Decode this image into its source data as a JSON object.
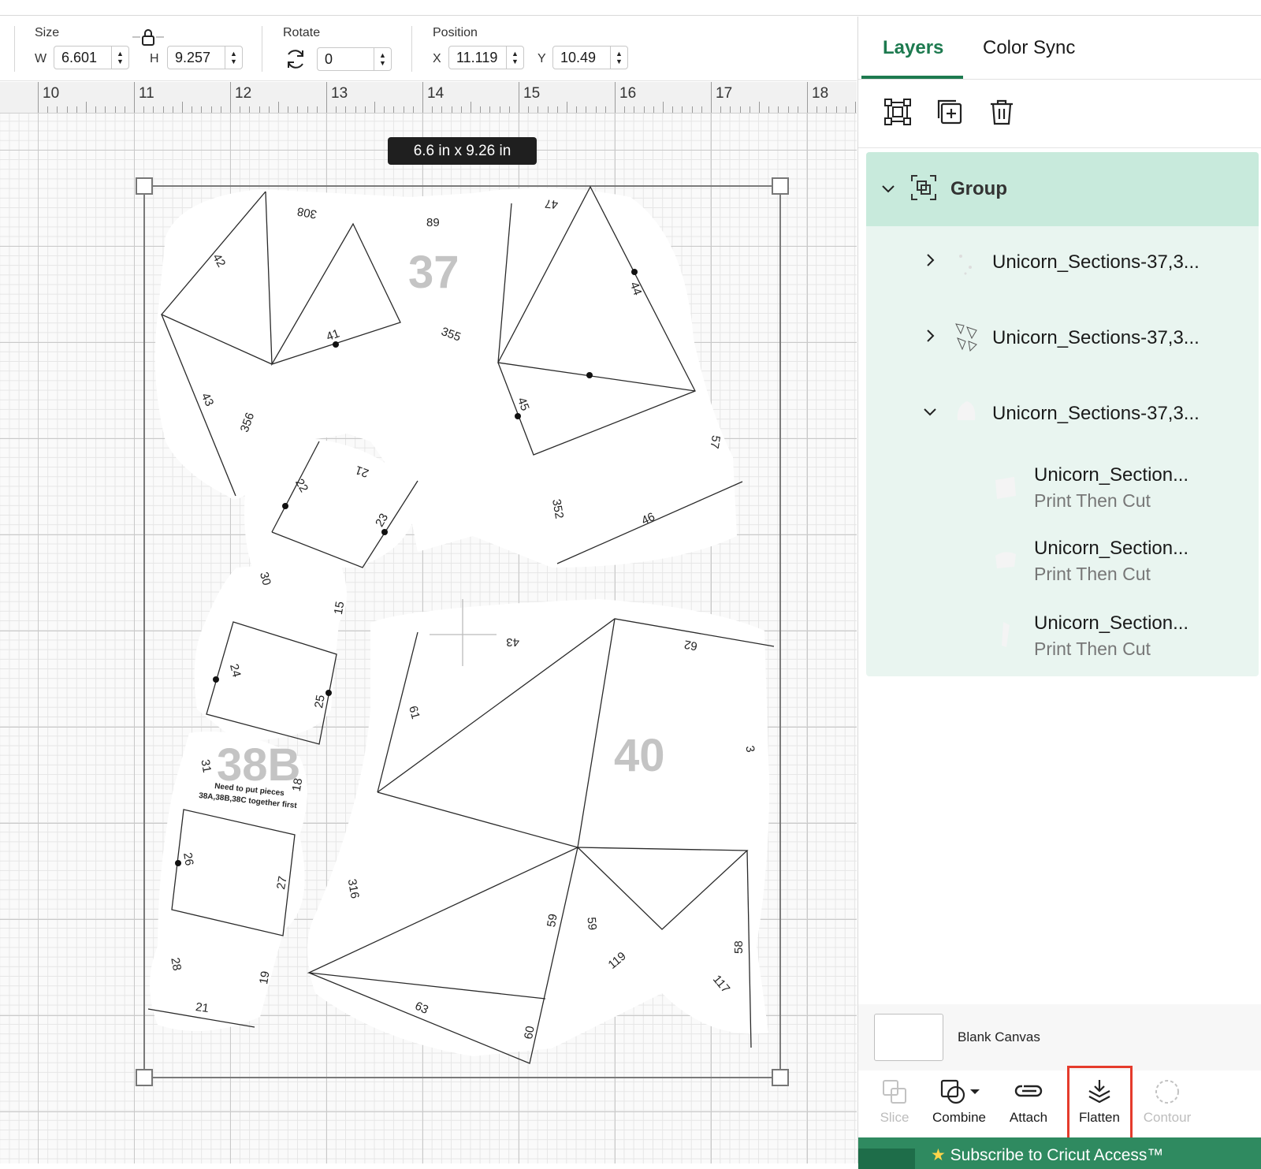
{
  "toolbar": {
    "size_label": "Size",
    "w_label": "W",
    "w_value": "6.601",
    "h_label": "H",
    "h_value": "9.257",
    "rotate_label": "Rotate",
    "rotate_value": "0",
    "position_label": "Position",
    "x_label": "X",
    "x_value": "11.119",
    "y_label": "Y",
    "y_value": "10.49"
  },
  "ruler": {
    "marks": [
      "10",
      "11",
      "12",
      "13",
      "14",
      "15",
      "16",
      "17",
      "18"
    ]
  },
  "canvas": {
    "dimension_tag": "6.6  in x 9.26  in",
    "labels": {
      "big_37": "37",
      "big_38b": "38B",
      "big_40": "40",
      "note_line1": "Need to put pieces",
      "note_line2": "38A,38B,38C together first",
      "n308": "308",
      "n89": "89",
      "n47": "47",
      "n42": "42",
      "n41": "41",
      "n355": "355",
      "n44": "44",
      "n43a": "43",
      "n356": "356",
      "n45": "45",
      "n57": "57",
      "n21a": "21",
      "n22": "22",
      "n23": "23",
      "n352": "352",
      "n46": "46",
      "n30": "30",
      "n15": "15",
      "n43b": "43",
      "n62": "62",
      "n24": "24",
      "n25": "25",
      "n61": "61",
      "n3": "3",
      "n31": "31",
      "n18": "18",
      "n26": "26",
      "n27": "27",
      "n316": "316",
      "n59a": "59",
      "n59b": "59",
      "n119": "119",
      "n58": "58",
      "n117": "117",
      "n28": "28",
      "n19": "19",
      "n21b": "21",
      "n63": "63",
      "n60": "60"
    }
  },
  "panel": {
    "tabs": [
      "Layers",
      "Color Sync"
    ],
    "icons": [
      "group-ungroup-icon",
      "duplicate-icon",
      "trash-icon"
    ],
    "group_label": "Group",
    "layers": [
      {
        "name": "Unicorn_Sections-37,3...",
        "expanded": false
      },
      {
        "name": "Unicorn_Sections-37,3...",
        "expanded": false
      },
      {
        "name": "Unicorn_Sections-37,3...",
        "expanded": true
      }
    ],
    "sublayers": [
      {
        "name": "Unicorn_Section...",
        "type": "Print Then Cut"
      },
      {
        "name": "Unicorn_Section...",
        "type": "Print Then Cut"
      },
      {
        "name": "Unicorn_Section...",
        "type": "Print Then Cut"
      }
    ],
    "blank_canvas_label": "Blank Canvas",
    "actions": [
      "Slice",
      "Combine",
      "Attach",
      "Flatten",
      "Contour"
    ],
    "subscribe_text": "Subscribe to Cricut Access™",
    "colors": {
      "accent": "#1d7a4f",
      "highlight": "#e53b2c",
      "group_bg": "#c8eadc",
      "layers_bg": "#e9f5f0"
    }
  }
}
